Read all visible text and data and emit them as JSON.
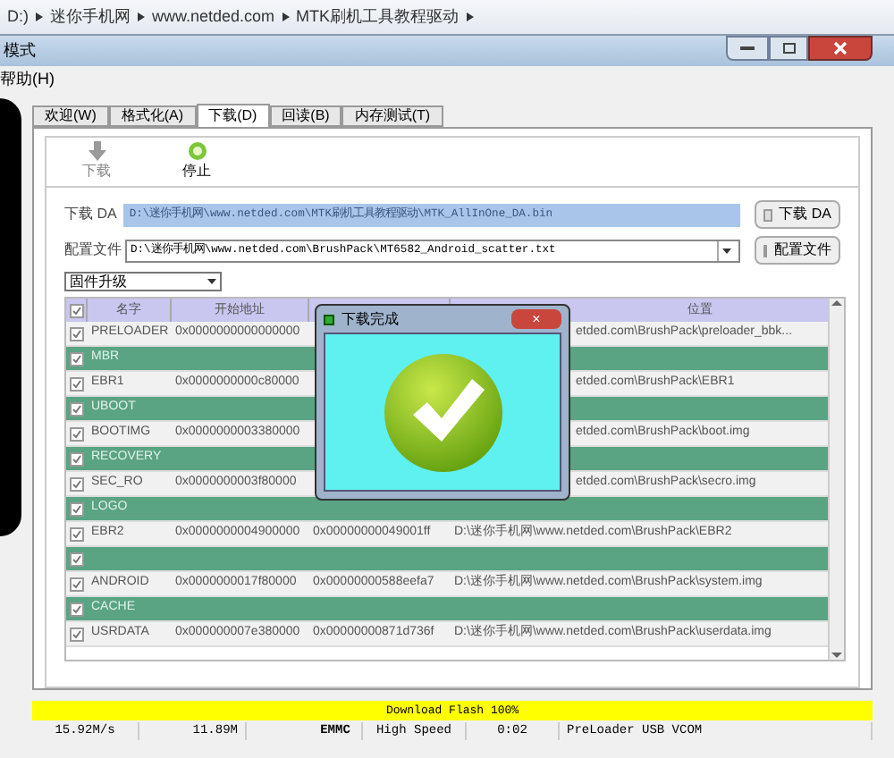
{
  "breadcrumb": [
    "D:)",
    "迷你手机网",
    "www.netded.com",
    "MTK刷机工具教程驱动"
  ],
  "window": {
    "title": "模式"
  },
  "menu": [
    "帮助(H)"
  ],
  "tabs": [
    {
      "label": "欢迎(W)",
      "selected": false
    },
    {
      "label": "格式化(A)",
      "selected": false
    },
    {
      "label": "下载(D)",
      "selected": true
    },
    {
      "label": "回读(B)",
      "selected": false
    },
    {
      "label": "内存测试(T)",
      "selected": false
    }
  ],
  "toolbar": [
    {
      "kind": "download",
      "label": "下载",
      "disabled": true
    },
    {
      "kind": "stop",
      "label": "停止",
      "disabled": false
    }
  ],
  "da": {
    "label": "下载 DA",
    "value": "D:\\迷你手机网\\www.netded.com\\MTK刷机工具教程驱动\\MTK_AllInOne_DA.bin",
    "button": "下载 DA"
  },
  "scatter": {
    "label": "配置文件",
    "value": "D:\\迷你手机网\\www.netded.com\\BrushPack\\MT6582_Android_scatter.txt",
    "button": "配置文件"
  },
  "mode": "固件升级",
  "table": {
    "columns": [
      "名字",
      "开始地址",
      "位置"
    ],
    "all_checked": true,
    "rows": [
      {
        "checked": true,
        "selected": false,
        "name": "PRELOADER",
        "start": "0x0000000000000000",
        "location": "etded.com\\BrushPack\\preloader_bbk..."
      },
      {
        "checked": true,
        "selected": true,
        "name": "MBR"
      },
      {
        "checked": true,
        "selected": false,
        "name": "EBR1",
        "start": "0x0000000000c80000",
        "location": "etded.com\\BrushPack\\EBR1"
      },
      {
        "checked": true,
        "selected": true,
        "name": "UBOOT"
      },
      {
        "checked": true,
        "selected": false,
        "name": "BOOTIMG",
        "start": "0x0000000003380000",
        "location": "etded.com\\BrushPack\\boot.img"
      },
      {
        "checked": true,
        "selected": true,
        "name": "RECOVERY"
      },
      {
        "checked": true,
        "selected": false,
        "name": "SEC_RO",
        "start": "0x0000000003f80000",
        "location": "etded.com\\BrushPack\\secro.img"
      },
      {
        "checked": true,
        "selected": true,
        "name": "LOGO"
      },
      {
        "checked": true,
        "selected": false,
        "name": "EBR2",
        "start": "0x0000000004900000",
        "end": "0x00000000049001ff",
        "location": "D:\\迷你手机网\\www.netded.com\\BrushPack\\EBR2"
      },
      {
        "checked": true,
        "selected": true
      },
      {
        "checked": true,
        "selected": false,
        "name": "ANDROID",
        "start": "0x0000000017f80000",
        "end": "0x00000000588eefa7",
        "location": "D:\\迷你手机网\\www.netded.com\\BrushPack\\system.img"
      },
      {
        "checked": true,
        "selected": true,
        "name": "CACHE"
      },
      {
        "checked": true,
        "selected": false,
        "name": "USRDATA",
        "start": "0x000000007e380000",
        "end": "0x00000000871d736f",
        "location": "D:\\迷你手机网\\www.netded.com\\BrushPack\\userdata.img"
      }
    ]
  },
  "dialog": {
    "title": "下载完成",
    "close": "×"
  },
  "progress": {
    "label": "Download Flash 100%",
    "level": 1
  },
  "status": [
    "15.92M/s",
    "11.89M",
    "EMMC",
    "High Speed",
    "0:02",
    "PreLoader USB VCOM"
  ]
}
